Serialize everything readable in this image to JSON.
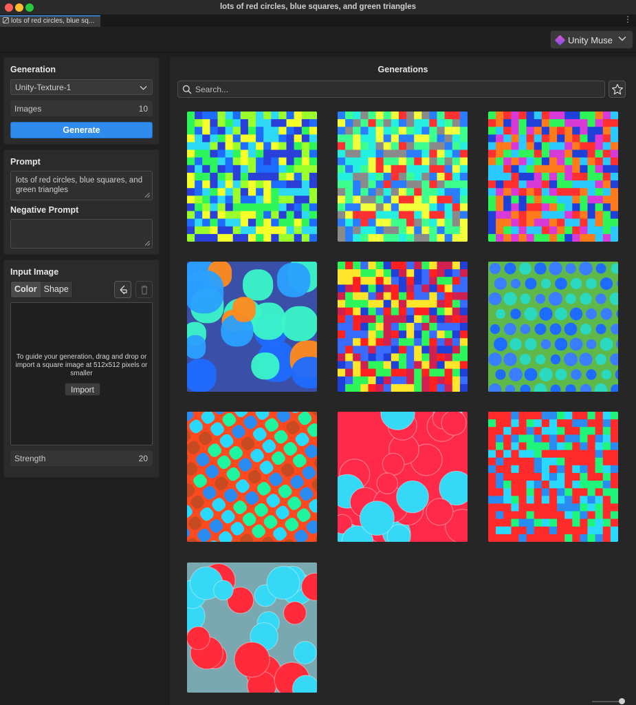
{
  "window": {
    "title": "lots of red circles, blue squares, and green triangles",
    "tab_label": "lots of red circles, blue sq..."
  },
  "toolbar": {
    "muse_label": "Unity Muse"
  },
  "generation": {
    "title": "Generation",
    "model": "Unity-Texture-1",
    "images_label": "Images",
    "images_value": "10",
    "generate_label": "Generate"
  },
  "prompt": {
    "title": "Prompt",
    "value": "lots of red circles, blue squares, and green triangles",
    "negative_title": "Negative Prompt",
    "negative_value": ""
  },
  "input_image": {
    "title": "Input Image",
    "tab_color": "Color",
    "tab_shape": "Shape",
    "hint": "To guide your generation, drag and drop or import a square image at 512x512 pixels or smaller",
    "import_label": "Import",
    "strength_label": "Strength",
    "strength_value": "20"
  },
  "generations": {
    "title": "Generations",
    "search_placeholder": "Search...",
    "items": [
      {
        "style": "squares",
        "palette": [
          "#2ef55a",
          "#1e6bff",
          "#f5ff2a",
          "#2dd9f5",
          "#9aff2a",
          "#2a3fd8"
        ]
      },
      {
        "style": "squares",
        "palette": [
          "#25f0e0",
          "#2a7dff",
          "#ff3030",
          "#f2ff3a",
          "#3cff90",
          "#8a8a8a"
        ]
      },
      {
        "style": "squares",
        "palette": [
          "#ff7a1a",
          "#1e3fd8",
          "#2ef55a",
          "#d83ad8",
          "#2ac9ff",
          "#ff3030"
        ]
      },
      {
        "style": "blobs",
        "background": "#3a4fa8",
        "palette": [
          "#3af5c8",
          "#1e6bff",
          "#ff8a1e",
          "#2aa0ff"
        ]
      },
      {
        "style": "squares",
        "palette": [
          "#ff2020",
          "#1e3fd8",
          "#3a6bff",
          "#2ef55a",
          "#ffe62a",
          "#d02050"
        ]
      },
      {
        "style": "dots",
        "background": "#5fb84a",
        "palette": [
          "#1e6bff",
          "#2ad9c0",
          "#3a7dff"
        ]
      },
      {
        "style": "diagonal",
        "background": "#ff4a20",
        "palette": [
          "#2a8bf0",
          "#1ef5a0",
          "#c84a20",
          "#2ad9ff"
        ]
      },
      {
        "style": "bigcircles",
        "background": "#ff2a4a",
        "palette": [
          "#35d8f5",
          "#ff2a4a"
        ]
      },
      {
        "style": "squares",
        "palette": [
          "#ff2a2a",
          "#2a8bf0",
          "#1ef57a",
          "#ff2a2a",
          "#ff2a2a",
          "#2ad9ff"
        ]
      },
      {
        "style": "bigcircles",
        "background": "#7aa8b0",
        "palette": [
          "#ff2a3a",
          "#35d8f5"
        ]
      }
    ]
  }
}
